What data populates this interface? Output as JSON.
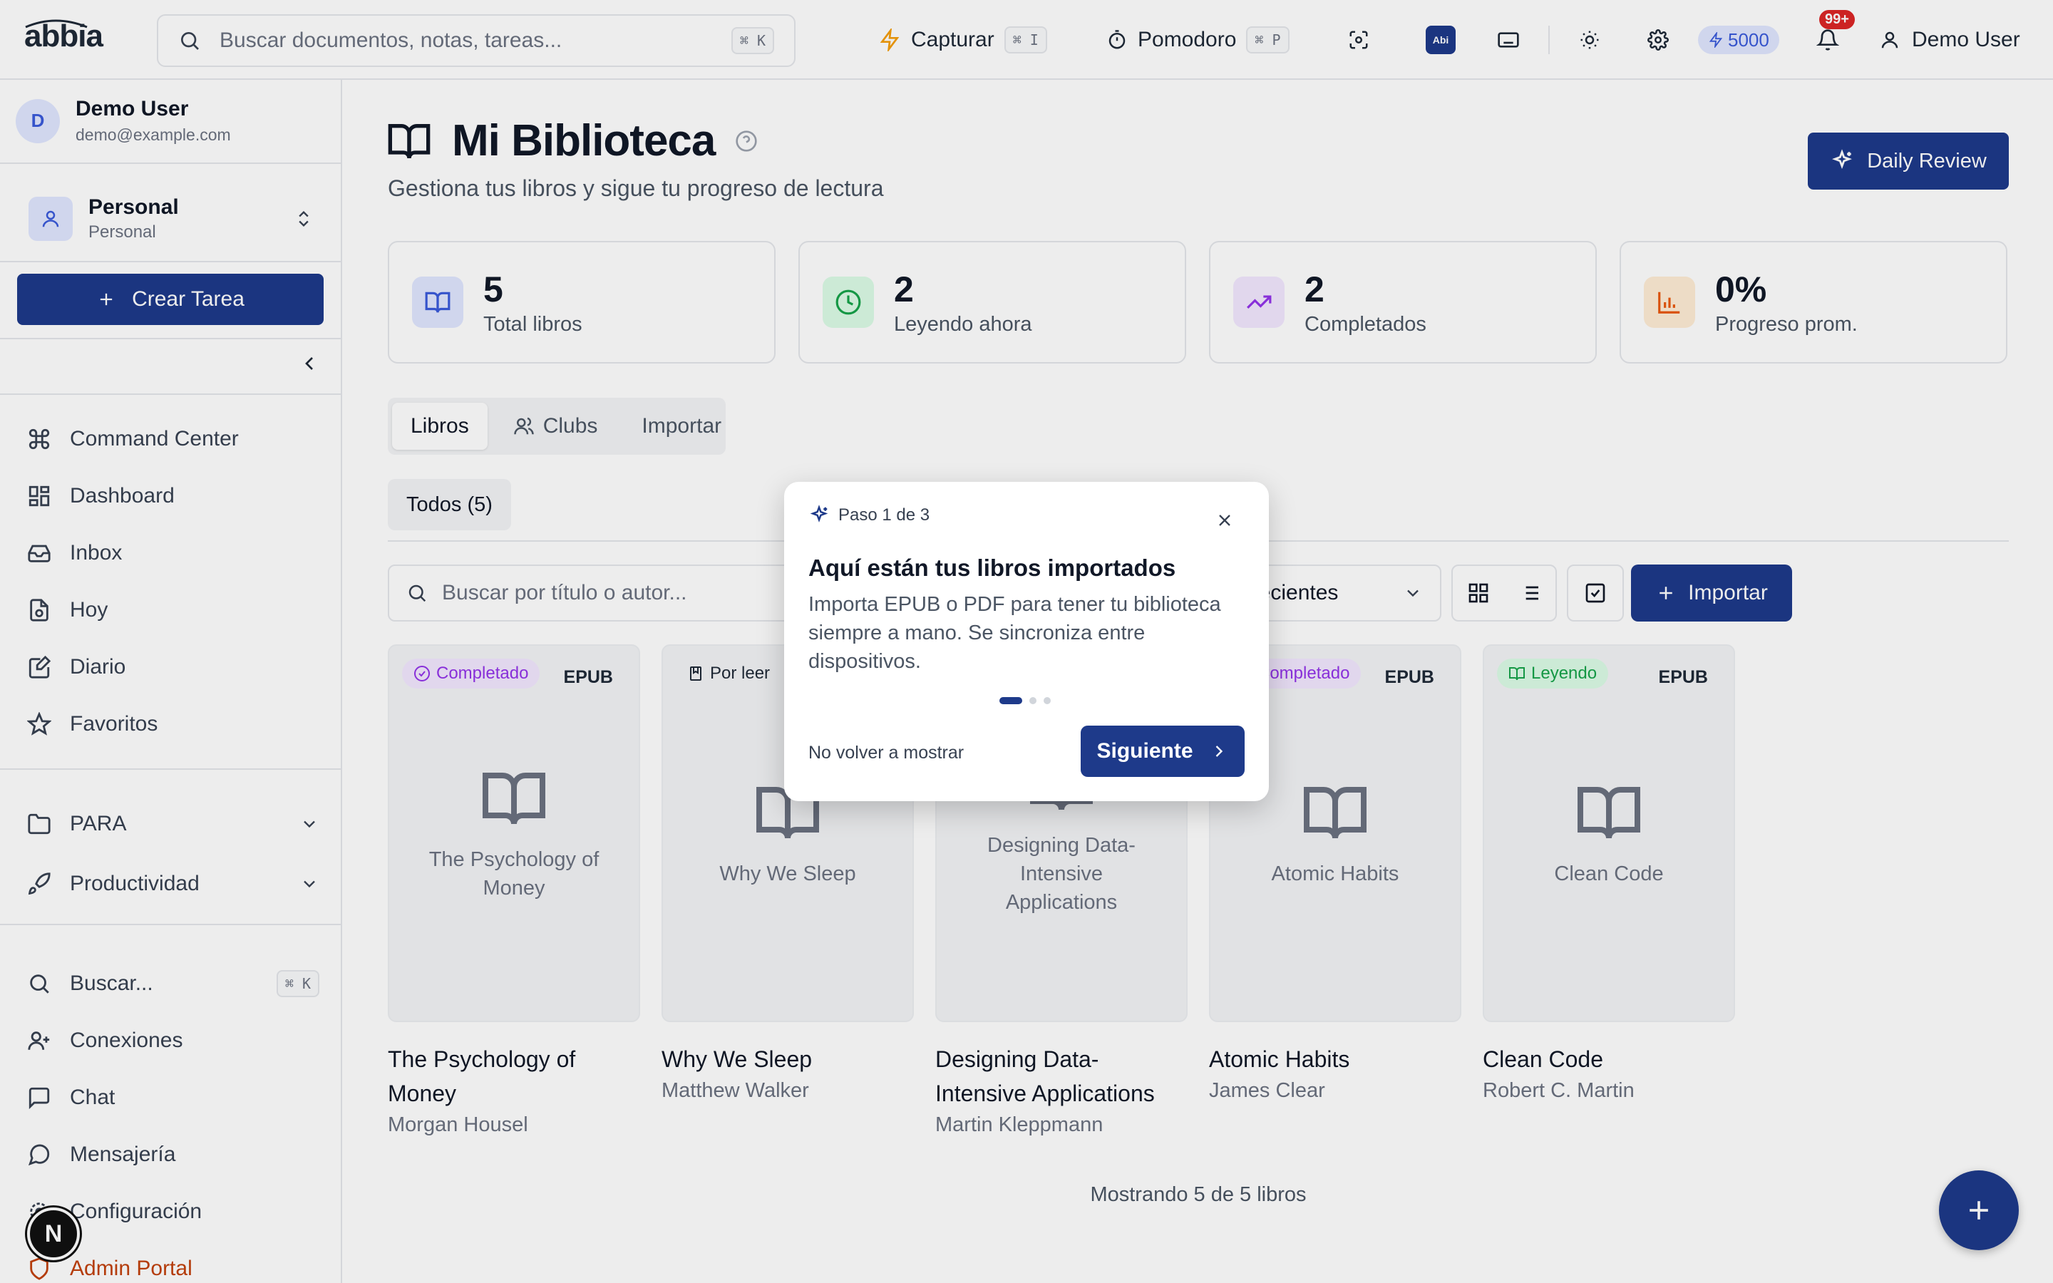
{
  "app": {
    "logo": "abbia"
  },
  "topbar": {
    "search_placeholder": "Buscar documentos, notas, tareas...",
    "search_shortcut": "⌘ K",
    "capture_label": "Capturar",
    "capture_shortcut": "⌘ I",
    "pomodoro_label": "Pomodoro",
    "pomodoro_shortcut": "⌘ P",
    "abi_badge": "Abi",
    "credits": "5000",
    "notifications_count": "99+",
    "user_name": "Demo User"
  },
  "sidebar": {
    "profile": {
      "initial": "D",
      "name": "Demo User",
      "email": "demo@example.com"
    },
    "workspace": {
      "title": "Personal",
      "subtitle": "Personal"
    },
    "create_task_label": "Crear Tarea",
    "nav_main": [
      {
        "label": "Command Center",
        "icon": "command-icon"
      },
      {
        "label": "Dashboard",
        "icon": "dashboard-icon"
      },
      {
        "label": "Inbox",
        "icon": "inbox-icon"
      },
      {
        "label": "Hoy",
        "icon": "today-icon"
      },
      {
        "label": "Diario",
        "icon": "journal-icon"
      },
      {
        "label": "Favoritos",
        "icon": "star-icon"
      }
    ],
    "nav_groups": [
      {
        "label": "PARA",
        "icon": "folder-icon"
      },
      {
        "label": "Productividad",
        "icon": "rocket-icon"
      }
    ],
    "search_label": "Buscar...",
    "search_shortcut": "⌘ K",
    "nav_bottom": [
      {
        "label": "Conexiones",
        "icon": "user-plus-icon"
      },
      {
        "label": "Chat",
        "icon": "chat-icon"
      },
      {
        "label": "Mensajería",
        "icon": "message-icon"
      },
      {
        "label": "Configuración",
        "icon": "gear-icon"
      },
      {
        "label": "Admin Portal",
        "icon": "shield-icon"
      }
    ],
    "next_badge": "N"
  },
  "page": {
    "title": "Mi Biblioteca",
    "subtitle": "Gestiona tus libros y sigue tu progreso de lectura",
    "daily_review_label": "Daily Review"
  },
  "stats": [
    {
      "value": "5",
      "label": "Total libros",
      "color": "#3b5bdb",
      "bg": "#e0e7ff"
    },
    {
      "value": "2",
      "label": "Leyendo ahora",
      "color": "#16a34a",
      "bg": "#dcfce7"
    },
    {
      "value": "2",
      "label": "Completados",
      "color": "#9333ea",
      "bg": "#f3e8ff"
    },
    {
      "value": "0%",
      "label": "Progreso prom.",
      "color": "#ea580c",
      "bg": "#ffedd5"
    }
  ],
  "tabs": [
    {
      "label": "Libros"
    },
    {
      "label": "Clubs"
    },
    {
      "label": "Importar"
    }
  ],
  "filter_chip": "Todos (5)",
  "toolbar": {
    "search_placeholder": "Buscar por título o autor...",
    "sort_label": "Recientes",
    "import_label": "Importar"
  },
  "books": [
    {
      "title": "The Psychology of Money",
      "author": "Morgan Housel",
      "status": "Completado",
      "format": "EPUB",
      "status_color": "#9333ea",
      "status_bg": "#f3e8ff"
    },
    {
      "title": "Why We Sleep",
      "author": "Matthew Walker",
      "status": "Por leer",
      "format": "",
      "status_color": "#1f2937",
      "status_bg": "transparent"
    },
    {
      "title": "Designing Data-Intensive Applications",
      "author": "Martin Kleppmann",
      "status": "",
      "format": "",
      "status_color": "#1f2937",
      "status_bg": "transparent"
    },
    {
      "title": "Atomic Habits",
      "author": "James Clear",
      "status": "Completado",
      "format": "EPUB",
      "status_color": "#9333ea",
      "status_bg": "#f3e8ff"
    },
    {
      "title": "Clean Code",
      "author": "Robert C. Martin",
      "status": "Leyendo",
      "format": "EPUB",
      "status_color": "#16a34a",
      "status_bg": "#dcfce7"
    }
  ],
  "showing_text": "Mostrando 5 de 5 libros",
  "onboarding": {
    "step": "Paso 1 de 3",
    "title": "Aquí están tus libros importados",
    "body": "Importa EPUB o PDF para tener tu biblioteca siempre a mano. Se sincroniza entre dispositivos.",
    "dismiss_label": "No volver a mostrar",
    "next_label": "Siguiente",
    "current_step": 1,
    "total_steps": 3
  },
  "colors": {
    "primary": "#1e3a8a",
    "admin": "#c2410c",
    "notification": "#dc2626"
  }
}
